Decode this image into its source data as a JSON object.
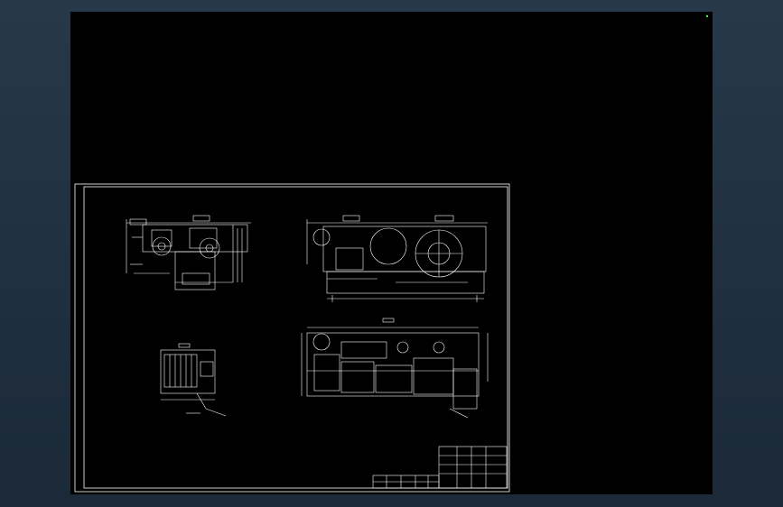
{
  "window": {
    "background": "#1e2d3c",
    "canvas_background": "#000000"
  },
  "colors": {
    "linework": "#ffffff",
    "title_block_text": "#39ff39",
    "ucs_marker": "#39ff39"
  },
  "icons": {
    "crosshair": "crosshair-icon"
  }
}
